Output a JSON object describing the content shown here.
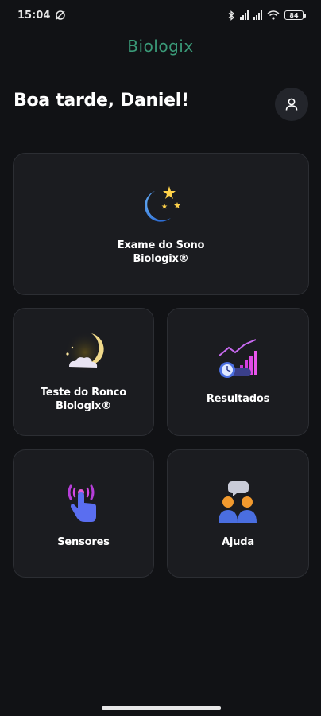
{
  "status_bar": {
    "time": "15:04",
    "battery": "84"
  },
  "app": {
    "brand": "Biologix"
  },
  "header": {
    "greeting": "Boa tarde, Daniel!"
  },
  "cards": [
    {
      "line1": "Exame do Sono",
      "line2": "Biologix®",
      "icon": "moon-stars-icon"
    },
    {
      "line1": "Teste do Ronco",
      "line2": "Biologix®",
      "icon": "moon-cloud-icon"
    },
    {
      "line1": "Resultados",
      "line2": "",
      "icon": "chart-clock-icon"
    },
    {
      "line1": "Sensores",
      "line2": "",
      "icon": "hand-signal-icon"
    },
    {
      "line1": "Ajuda",
      "line2": "",
      "icon": "people-chat-icon"
    }
  ],
  "colors": {
    "background": "#111215",
    "card": "#1b1c20",
    "brand": "#3a9a78"
  }
}
